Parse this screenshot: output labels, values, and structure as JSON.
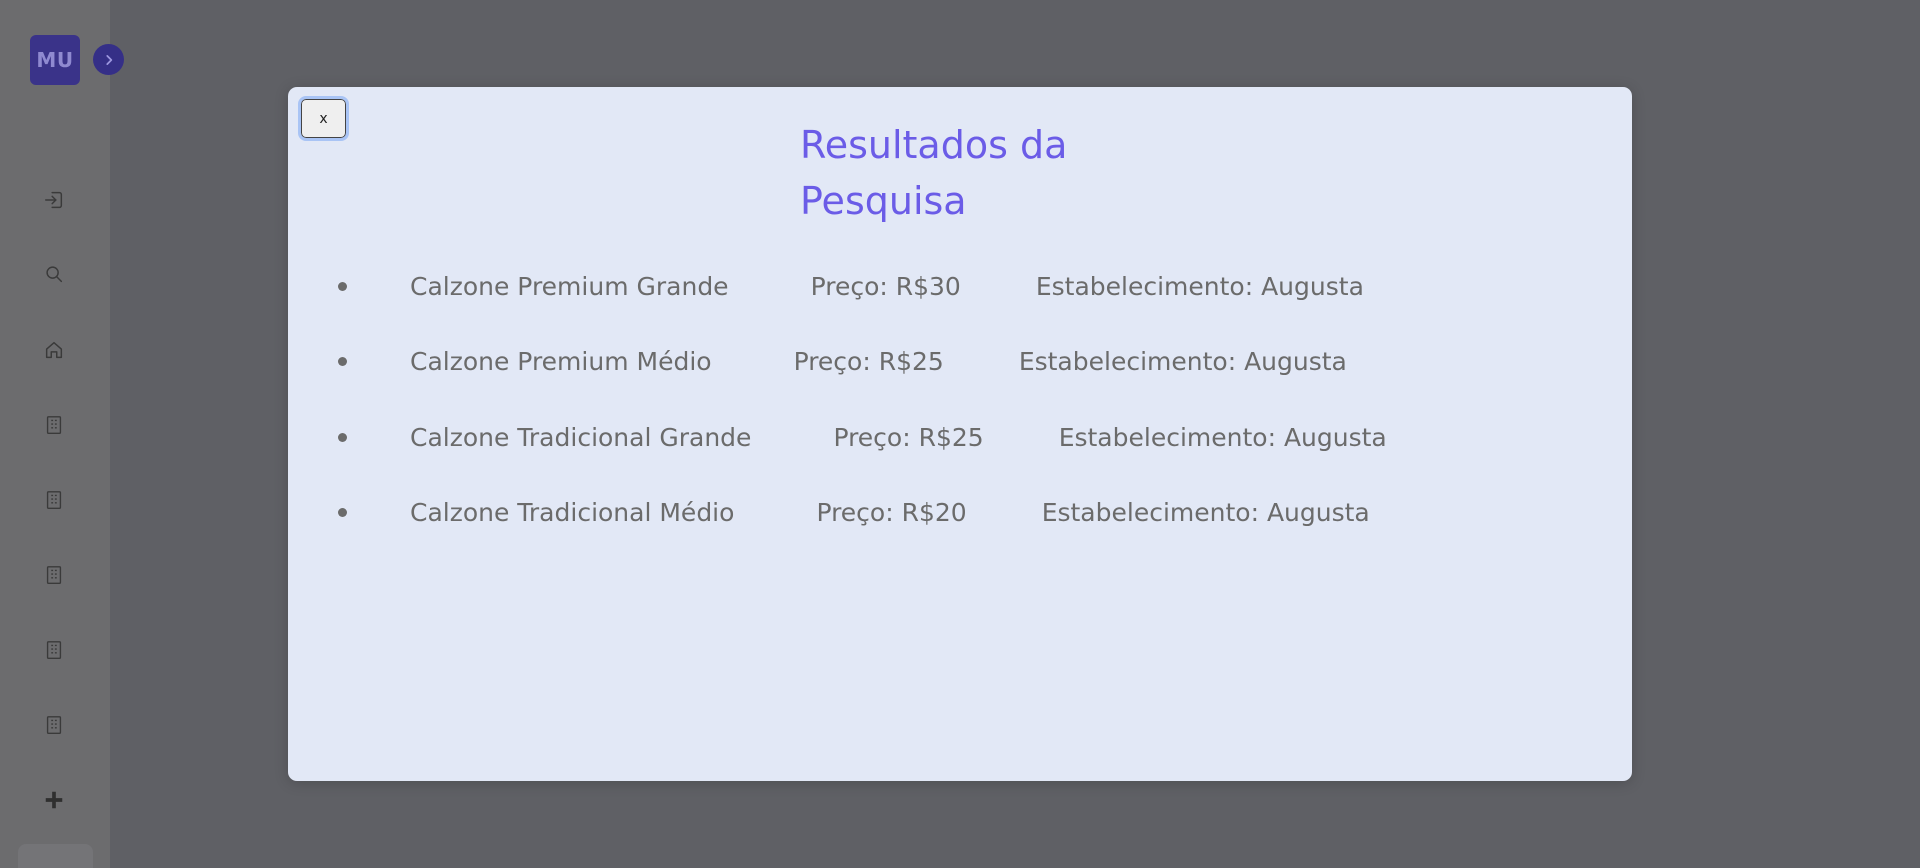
{
  "sidebar": {
    "logo_text": "MU",
    "icons": [
      {
        "name": "login-icon"
      },
      {
        "name": "search-icon"
      },
      {
        "name": "home-icon"
      },
      {
        "name": "building-icon"
      },
      {
        "name": "building-icon"
      },
      {
        "name": "building-icon"
      },
      {
        "name": "building-icon"
      },
      {
        "name": "building-icon"
      },
      {
        "name": "plus-icon"
      }
    ]
  },
  "modal": {
    "close_label": "x",
    "title_line1": "Resultados da",
    "title_line2": "Pesquisa",
    "results": [
      {
        "name": "Calzone Premium Grande",
        "price": "Preço: R$30",
        "store": "Estabelecimento: Augusta"
      },
      {
        "name": "Calzone Premium Médio",
        "price": "Preço: R$25",
        "store": "Estabelecimento: Augusta"
      },
      {
        "name": "Calzone Tradicional Grande",
        "price": "Preço: R$25",
        "store": "Estabelecimento: Augusta"
      },
      {
        "name": "Calzone Tradicional Médio",
        "price": "Preço: R$20",
        "store": "Estabelecimento: Augusta"
      }
    ]
  },
  "colors": {
    "accent": "#6b5ce7",
    "modal_bg": "#e2e8f6",
    "overlay": "#5f6065",
    "logo_bg": "#3a3389"
  }
}
